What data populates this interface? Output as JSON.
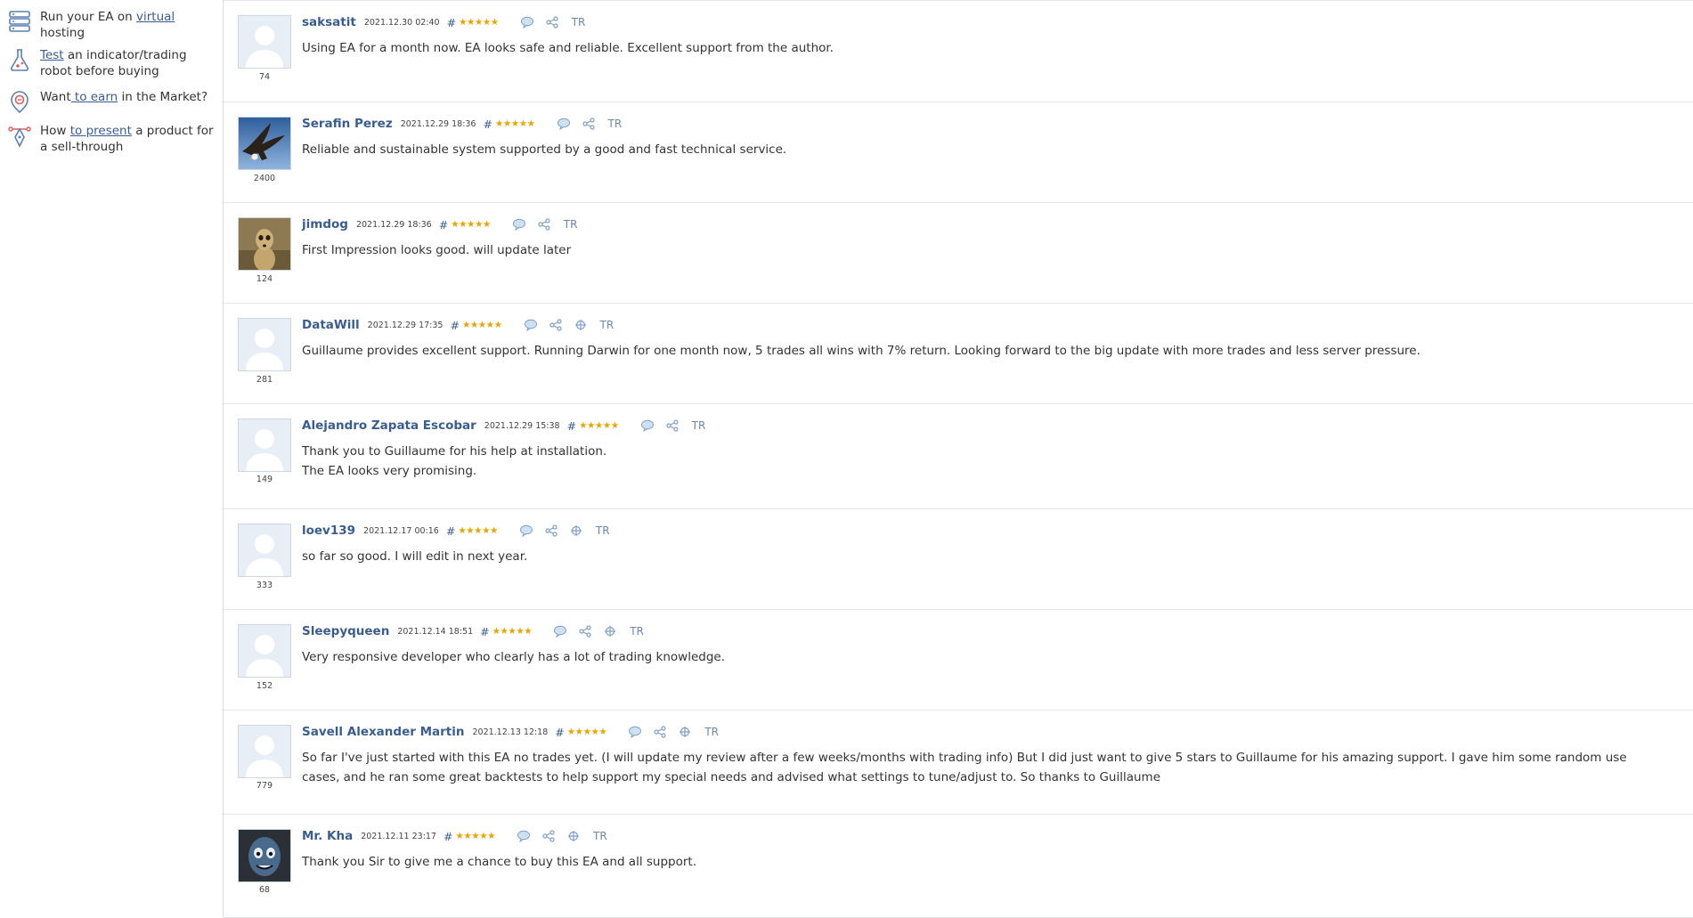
{
  "sidebar": {
    "items": [
      {
        "icon": "server-icon",
        "before": "Run your EA on ",
        "link": "virtual",
        "after": " hosting"
      },
      {
        "icon": "flask-icon",
        "before": "",
        "link": "Test",
        "after": " an indicator/trading robot before buying"
      },
      {
        "icon": "earn-icon",
        "before": "Want",
        "link": " to earn",
        "after": " in the Market?"
      },
      {
        "icon": "pen-tool-icon",
        "before": "How ",
        "link": "to present",
        "after": " a product for a sell-through"
      }
    ]
  },
  "colors": {
    "link": "#3a5d8f",
    "stars": "#e7a500",
    "translate": "#6f87a8"
  },
  "reviews": [
    {
      "author": "saksatit",
      "date": "2021.12.30 02:40",
      "hash": "#",
      "stars": "★★★★★",
      "rating": 5,
      "count": "74",
      "avatar": "default-avatar",
      "text": "Using EA for a month now. EA looks safe and reliable. Excellent support from the author.",
      "translate": "TR",
      "actions": [
        "comment-icon",
        "share-icon"
      ]
    },
    {
      "author": "Serafin Perez",
      "date": "2021.12.29 18:36",
      "hash": "#",
      "stars": "★★★★★",
      "rating": 5,
      "count": "2400",
      "avatar": "eagle-photo",
      "text": "Reliable and sustainable system supported by a good and fast technical service.",
      "translate": "TR",
      "actions": [
        "comment-icon",
        "share-icon"
      ]
    },
    {
      "author": "jimdog",
      "date": "2021.12.29 18:36",
      "hash": "#",
      "stars": "★★★★★",
      "rating": 5,
      "count": "124",
      "avatar": "meerkat-photo",
      "text": "First Impression looks good. will update later",
      "translate": "TR",
      "actions": [
        "comment-icon",
        "share-icon"
      ]
    },
    {
      "author": "DataWill",
      "date": "2021.12.29 17:35",
      "hash": "#",
      "stars": "★★★★★",
      "rating": 5,
      "count": "281",
      "avatar": "default-avatar",
      "text": "Guillaume provides excellent support. Running Darwin for one month now, 5 trades all wins with 7% return. Looking forward to the big update with more trades and less server pressure.",
      "translate": "TR",
      "actions": [
        "comment-icon",
        "share-icon",
        "add-icon"
      ]
    },
    {
      "author": "Alejandro Zapata Escobar",
      "date": "2021.12.29 15:38",
      "hash": "#",
      "stars": "★★★★★",
      "rating": 5,
      "count": "149",
      "avatar": "default-avatar",
      "text": "Thank you to Guillaume for his help at installation.\nThe EA looks very promising.",
      "translate": "TR",
      "actions": [
        "comment-icon",
        "share-icon"
      ]
    },
    {
      "author": "loev139",
      "date": "2021.12.17 00:16",
      "hash": "#",
      "stars": "★★★★★",
      "rating": 5,
      "count": "333",
      "avatar": "default-avatar",
      "text": "so far so good. I will edit in next year.",
      "translate": "TR",
      "actions": [
        "comment-icon",
        "share-icon",
        "add-icon"
      ]
    },
    {
      "author": "Sleepyqueen",
      "date": "2021.12.14 18:51",
      "hash": "#",
      "stars": "★★★★★",
      "rating": 5,
      "count": "152",
      "avatar": "default-avatar",
      "text": "Very responsive developer who clearly has a lot of trading knowledge.",
      "translate": "TR",
      "actions": [
        "comment-icon",
        "share-icon",
        "add-icon"
      ]
    },
    {
      "author": "Savell Alexander Martin",
      "date": "2021.12.13 12:18",
      "hash": "#",
      "stars": "★★★★★",
      "rating": 5,
      "count": "779",
      "avatar": "default-avatar",
      "text": "So far I've just started with this EA no trades yet. (I will update my review after a few weeks/months with trading info) But I did just want to give 5 stars to Guillaume for his amazing support. I gave him some random use cases, and he ran some great backtests to help support my special needs and advised what settings to tune/adjust to. So thanks to Guillaume",
      "translate": "TR",
      "actions": [
        "comment-icon",
        "share-icon",
        "add-icon"
      ]
    },
    {
      "author": "Mr. Kha",
      "date": "2021.12.11 23:17",
      "hash": "#",
      "stars": "★★★★★",
      "rating": 5,
      "count": "68",
      "avatar": "cartoon-face-photo",
      "text": "Thank you Sir to give me a chance to buy this EA and all support.",
      "translate": "TR",
      "actions": [
        "comment-icon",
        "share-icon",
        "add-icon"
      ]
    }
  ]
}
